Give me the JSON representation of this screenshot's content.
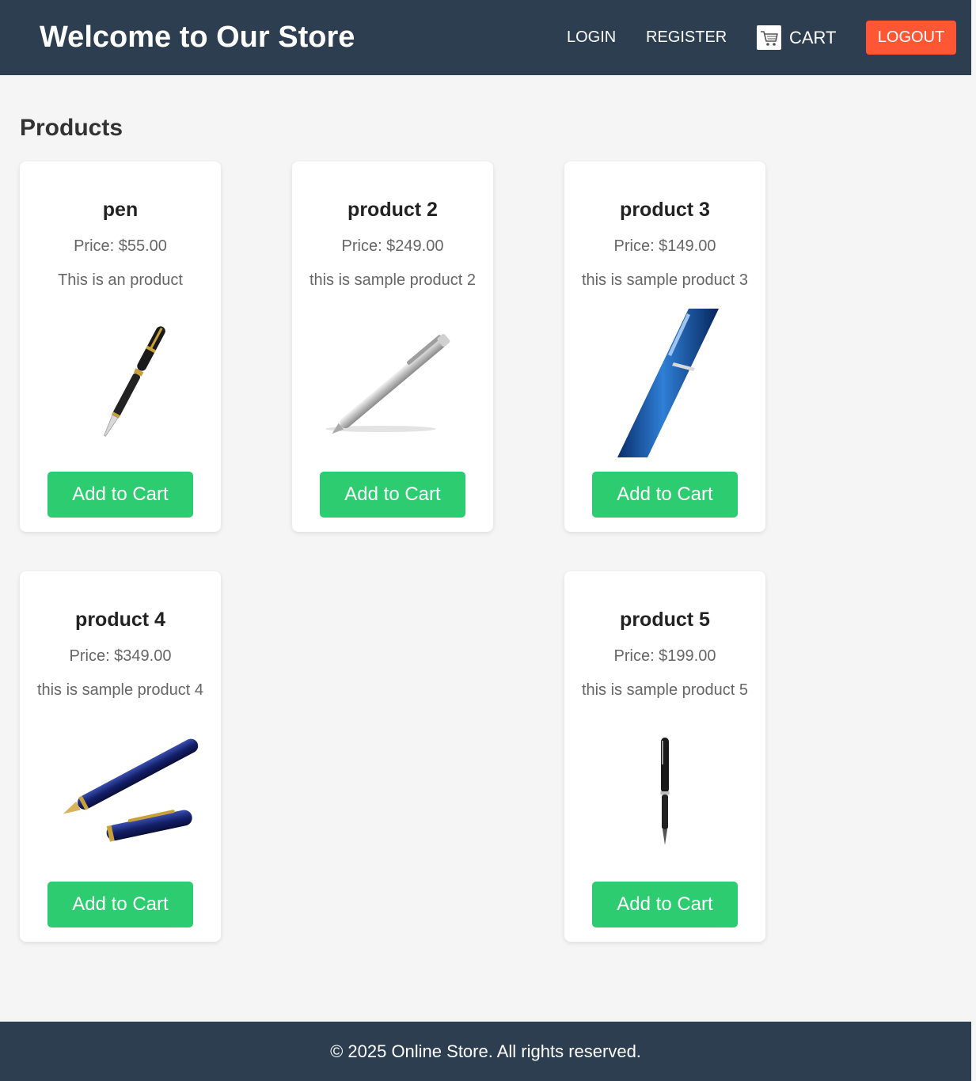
{
  "header": {
    "title": "Welcome to Our Store",
    "nav": {
      "login": "LOGIN",
      "register": "REGISTER",
      "cart": "CART",
      "cart_icon": "shopping-cart-icon",
      "logout": "LOGOUT"
    }
  },
  "main": {
    "section_title": "Products",
    "price_prefix": "Price: ",
    "add_to_cart_label": "Add to Cart",
    "products": [
      {
        "name": "pen",
        "price": "$55.00",
        "price_text": "Price: $55.00",
        "description": "This is an product",
        "image": "black-gold-fountain-pen"
      },
      {
        "name": "product 2",
        "price": "$249.00",
        "price_text": "Price: $249.00",
        "description": "this is sample product 2",
        "image": "silver-ballpoint-pen"
      },
      {
        "name": "product 3",
        "price": "$149.00",
        "price_text": "Price: $149.00",
        "description": "this is sample product 3",
        "image": "blue-ballpoint-pen"
      },
      {
        "name": "product 4",
        "price": "$349.00",
        "price_text": "Price: $349.00",
        "description": "this is sample product 4",
        "image": "navy-fountain-pen-with-cap"
      },
      {
        "name": "product 5",
        "price": "$199.00",
        "price_text": "Price: $199.00",
        "description": "this is sample product 5",
        "image": "black-rollerball-pen"
      }
    ]
  },
  "footer": {
    "text": "© 2025 Online Store. All rights reserved."
  },
  "colors": {
    "header_bg": "#2c3e50",
    "logout_bg": "#ff5733",
    "add_to_cart_bg": "#2ecc71",
    "page_bg": "#f5f5f5"
  }
}
